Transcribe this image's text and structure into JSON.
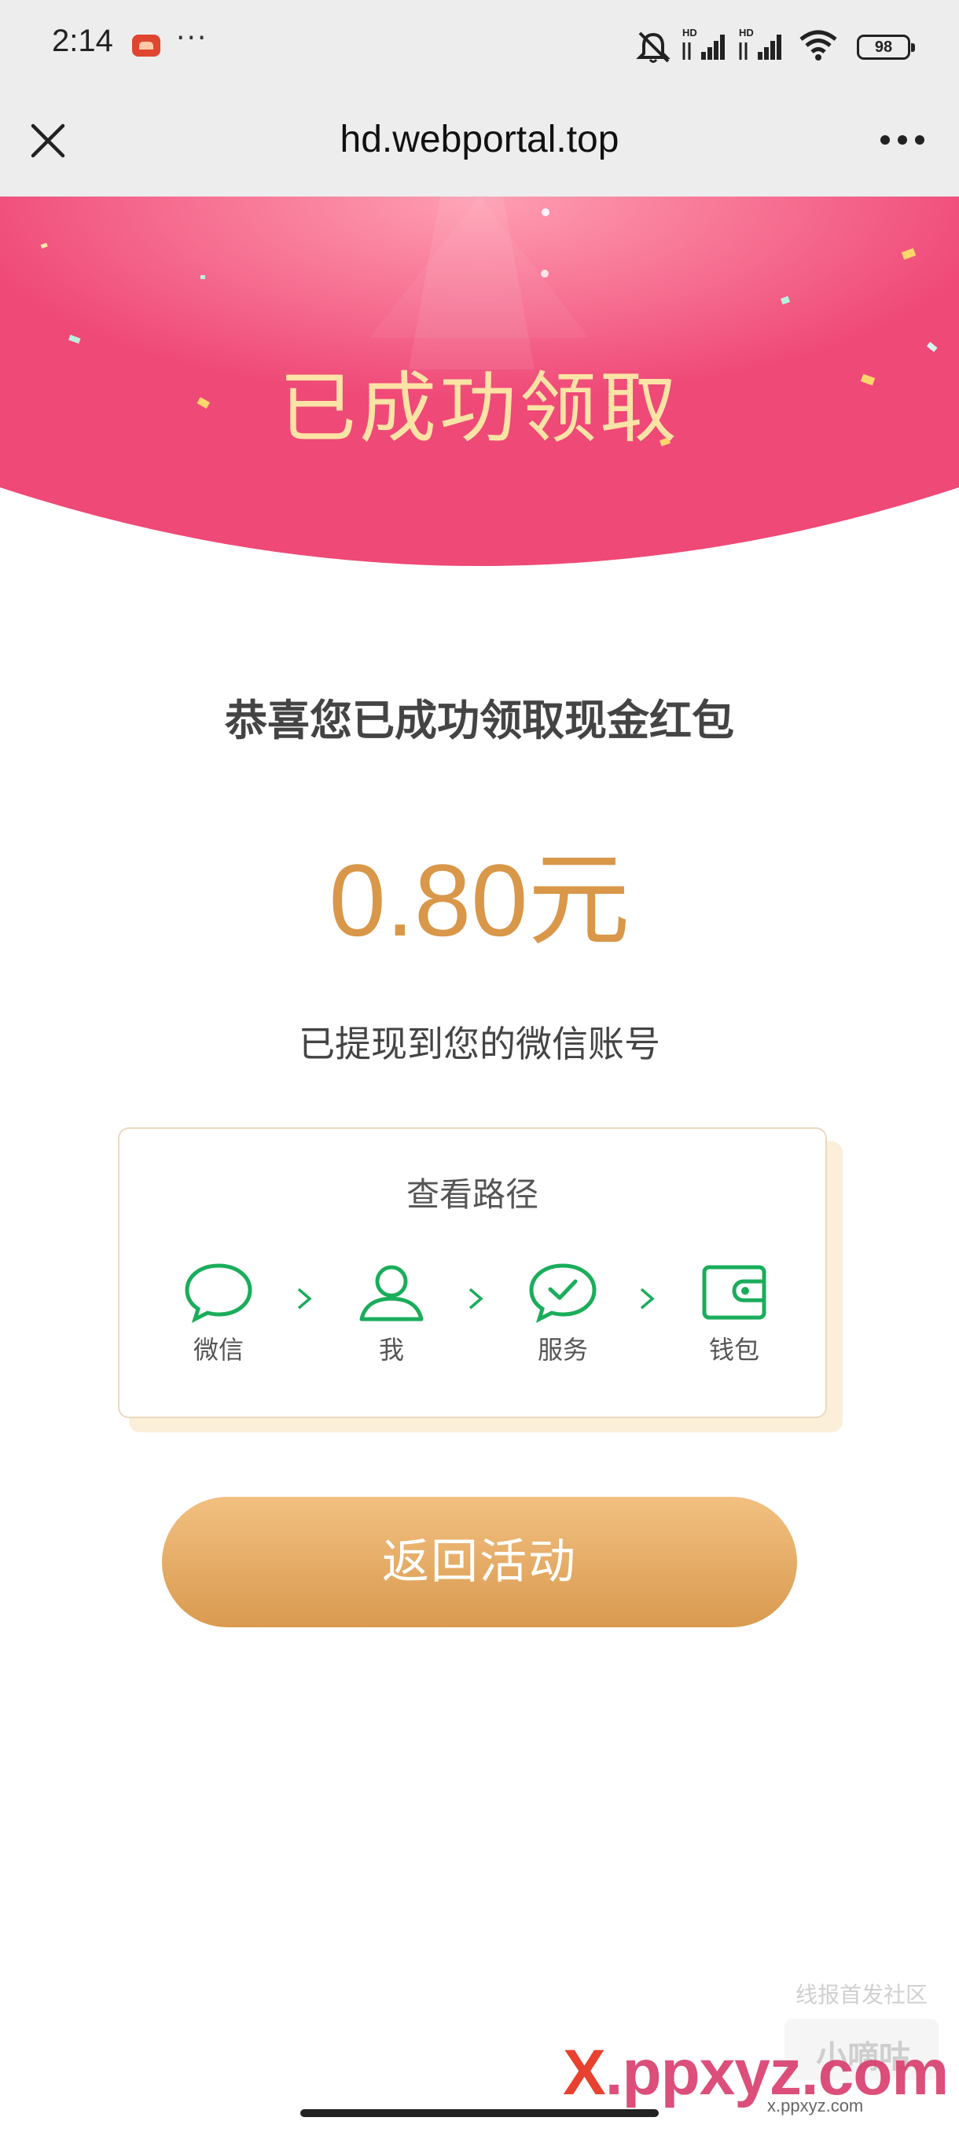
{
  "status_bar": {
    "time": "2:14",
    "more": "···",
    "battery": "98",
    "icons": [
      "app-notification-icon",
      "silent-icon",
      "hd-signal-icon",
      "hd-signal-icon",
      "wifi-icon",
      "battery-icon"
    ]
  },
  "titlebar": {
    "url": "hd.webportal.top",
    "close_icon": "close-icon",
    "menu_icon": "more-dots-icon"
  },
  "banner": {
    "title": "已成功领取",
    "background_color": "#f0507a",
    "title_color": "#fbe3a5"
  },
  "content": {
    "congrats": "恭喜您已成功领取现金红包",
    "amount": "0.80元",
    "amount_color": "#d99749",
    "withdrawn": "已提现到您的微信账号"
  },
  "path_card": {
    "title": "查看路径",
    "steps": [
      {
        "label": "微信",
        "icon": "chat-bubble-icon"
      },
      {
        "label": "我",
        "icon": "user-icon"
      },
      {
        "label": "服务",
        "icon": "check-bubble-icon"
      },
      {
        "label": "钱包",
        "icon": "wallet-icon"
      }
    ],
    "icon_color": "#1aad5b"
  },
  "button": {
    "label": "返回活动",
    "color": "#e2a85f"
  },
  "watermark": {
    "top": "线报首发社区",
    "badge": "小嘀咕",
    "main_x": "X",
    "main_rest": ".ppxyz.com",
    "sub": "x.ppxyz.com"
  }
}
